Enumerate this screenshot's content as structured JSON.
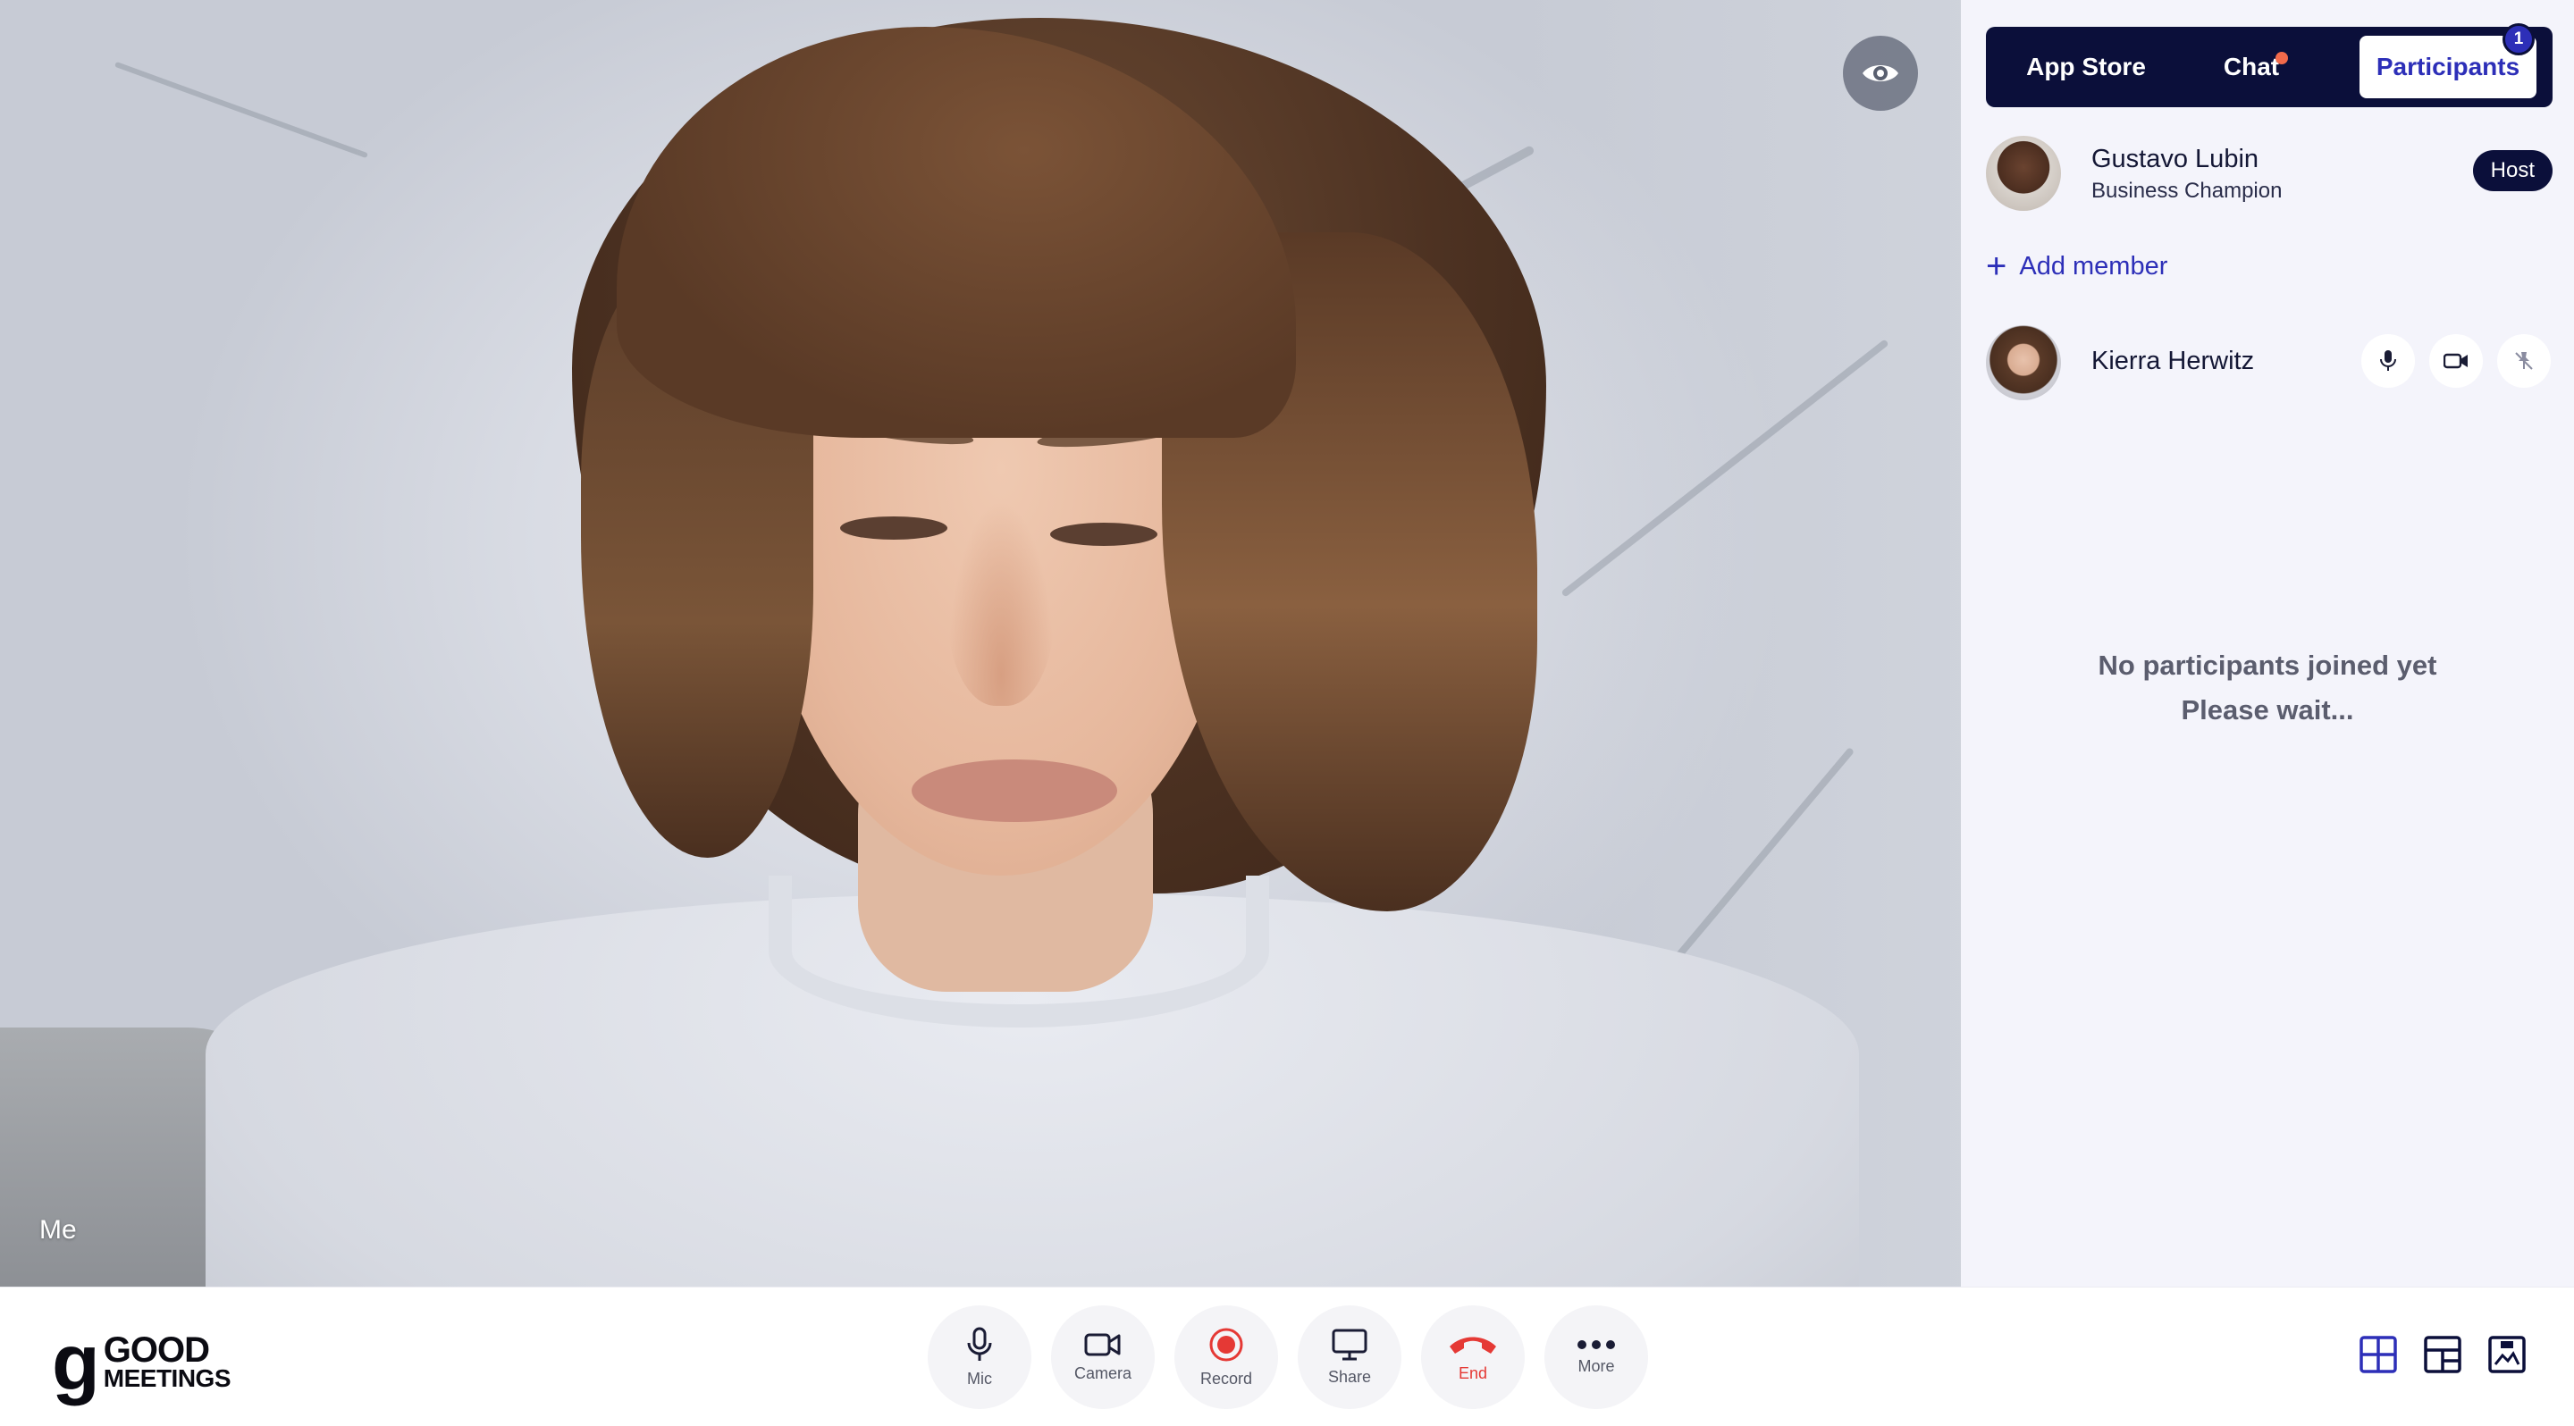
{
  "video": {
    "self_label": "Me"
  },
  "sidebar": {
    "tabs": [
      {
        "label": "App Store"
      },
      {
        "label": "Chat",
        "has_unread": true
      },
      {
        "label": "Participants",
        "count": "1",
        "active": true
      }
    ],
    "host": {
      "name": "Gustavo Lubin",
      "role": "Business Champion",
      "badge": "Host"
    },
    "add_member_label": "Add member",
    "members": [
      {
        "name": "Kierra Herwitz"
      }
    ],
    "empty_state": {
      "line1": "No participants joined yet",
      "line2": "Please wait..."
    }
  },
  "brand": {
    "mark": "g",
    "line1": "GOOD",
    "line2": "MEETINGS"
  },
  "controls": [
    {
      "label": "Mic",
      "icon": "mic-icon"
    },
    {
      "label": "Camera",
      "icon": "camera-icon"
    },
    {
      "label": "Record",
      "icon": "record-icon"
    },
    {
      "label": "Share",
      "icon": "share-screen-icon"
    },
    {
      "label": "End",
      "icon": "end-call-icon"
    },
    {
      "label": "More",
      "icon": "more-icon"
    }
  ],
  "colors": {
    "accent": "#2d2fb8",
    "navy": "#0b0f3a",
    "end_red": "#e53935",
    "record_red": "#e53935",
    "chat_dot": "#f26a4b"
  }
}
